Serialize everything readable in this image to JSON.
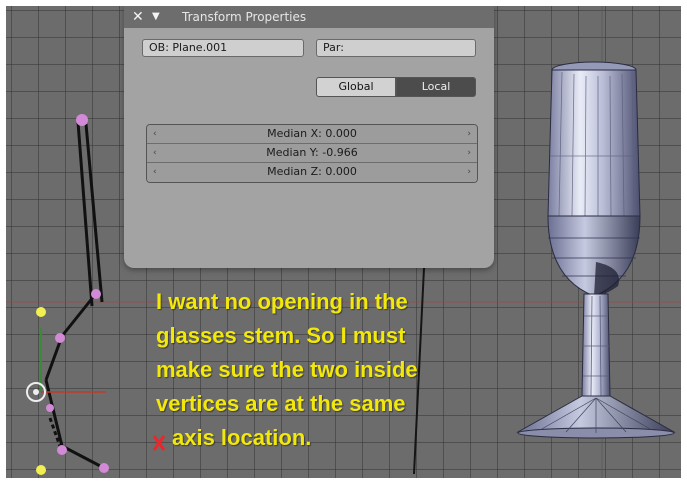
{
  "panel": {
    "title": "Transform Properties",
    "close_glyph": "✕",
    "collapse_glyph": "▼",
    "object_name": "OB: Plane.001",
    "parent_label": "Par:",
    "global_label": "Global",
    "local_label": "Local",
    "median_x": "Median X: 0.000",
    "median_y": "Median Y: -0.966",
    "median_z": "Median Z: 0.000",
    "arrow_left": "‹",
    "arrow_right": "›"
  },
  "annotation": {
    "lines": [
      "I want no opening in the",
      "glasses stem.  So I must",
      "make sure the two inside",
      "vertices are at the same",
      "axis location."
    ],
    "x_marker": "x"
  },
  "colors": {
    "annotation_text": "#f2e80a",
    "x_marker": "#e8282a",
    "vertex": "#d28ad6",
    "selected_vertex": "#f1f050",
    "axis_x": "#c0392b",
    "axis_y": "#3a8a3a"
  }
}
